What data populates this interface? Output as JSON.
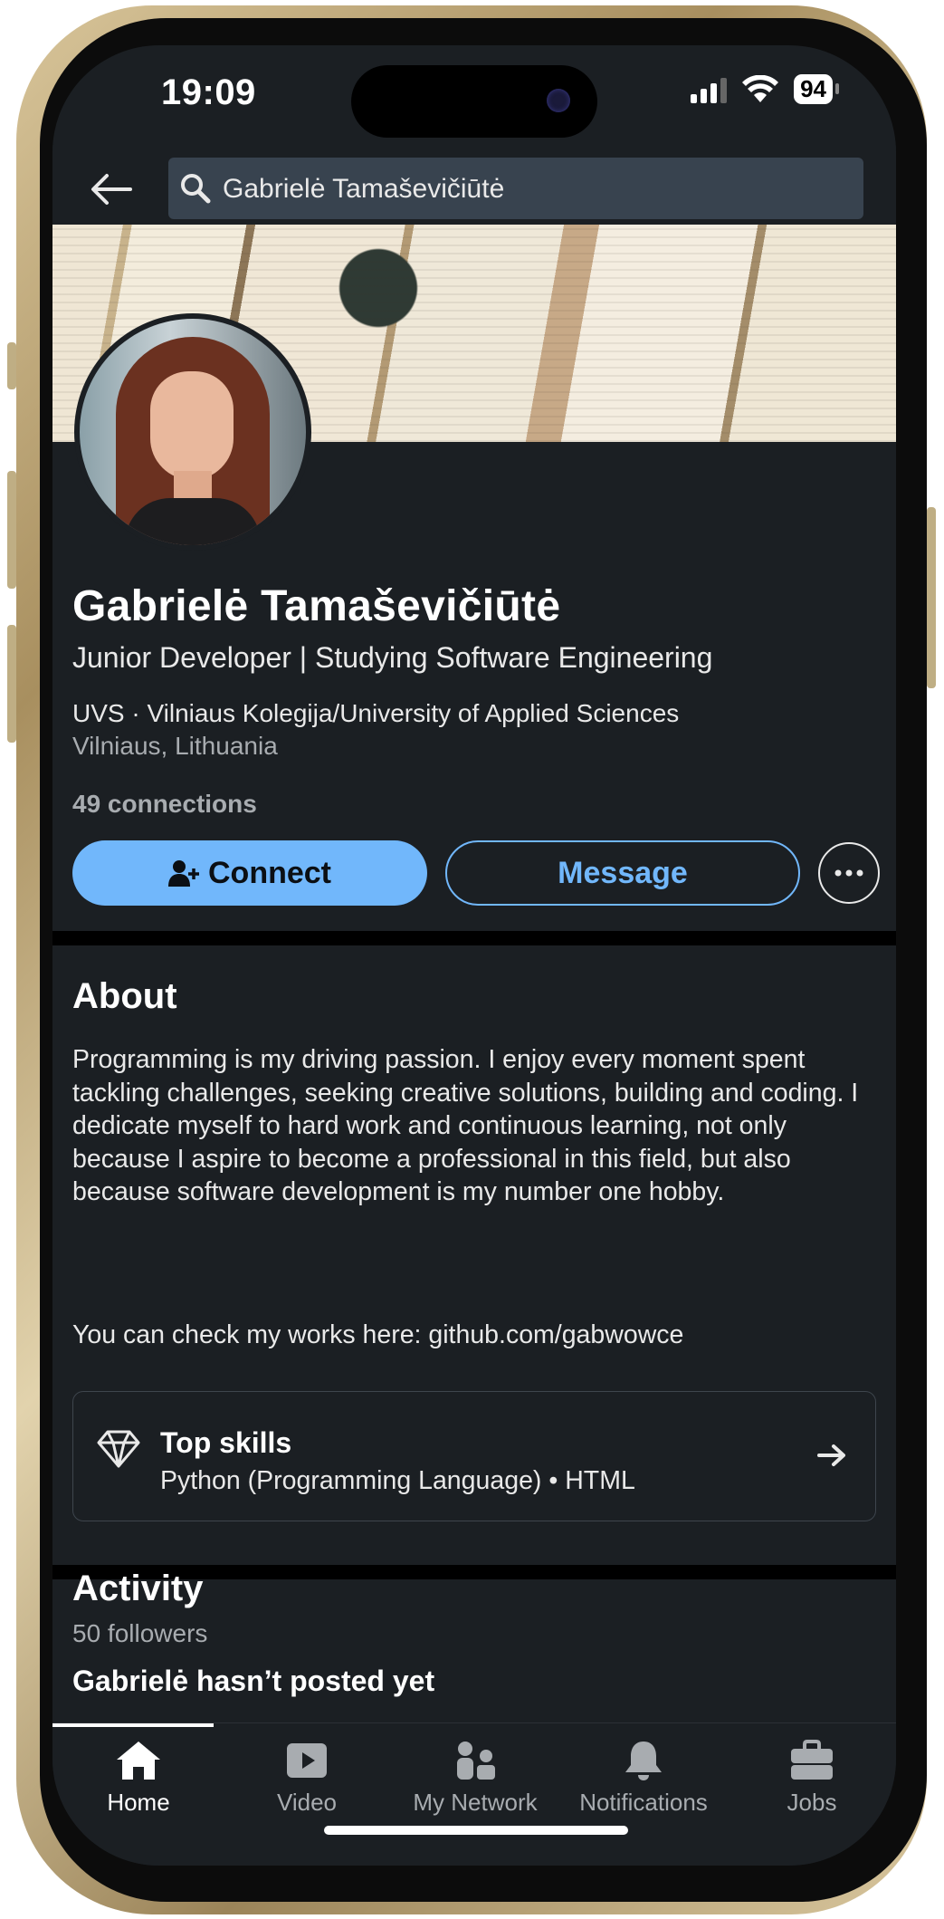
{
  "status_bar": {
    "time": "19:09",
    "battery": "94"
  },
  "search": {
    "query": "Gabrielė Tamaševičiūtė"
  },
  "profile": {
    "name": "Gabrielė Tamaševičiūtė",
    "headline": "Junior Developer | Studying Software Engineering",
    "education": "UVS · Vilniaus Kolegija/University of Applied Sciences",
    "location": "Vilniaus, Lithuania",
    "connections": "49 connections",
    "connect_label": "Connect",
    "message_label": "Message"
  },
  "about": {
    "title": "About",
    "text": "Programming is my driving passion. I enjoy every moment spent tackling challenges, seeking creative solutions, building and coding. I dedicate myself to hard work and continuous learning, not only because I aspire to become a professional in this field, but also because software development is my number one hobby.",
    "link_line": "You can check my works here: github.com/gabwowce",
    "top_skills_title": "Top skills",
    "top_skills": "Python (Programming Language) • HTML"
  },
  "activity": {
    "title": "Activity",
    "followers": "50 followers",
    "empty_state": "Gabrielė hasn’t posted yet"
  },
  "tabs": [
    {
      "label": "Home",
      "icon": "home-icon",
      "active": true
    },
    {
      "label": "Video",
      "icon": "video-icon",
      "active": false
    },
    {
      "label": "My Network",
      "icon": "network-icon",
      "active": false
    },
    {
      "label": "Notifications",
      "icon": "bell-icon",
      "active": false
    },
    {
      "label": "Jobs",
      "icon": "briefcase-icon",
      "active": false
    }
  ],
  "colors": {
    "background": "#1b1f23",
    "accent": "#71b7fb",
    "frame": "#c8b48a",
    "secondary_text": "#a8acb0"
  }
}
